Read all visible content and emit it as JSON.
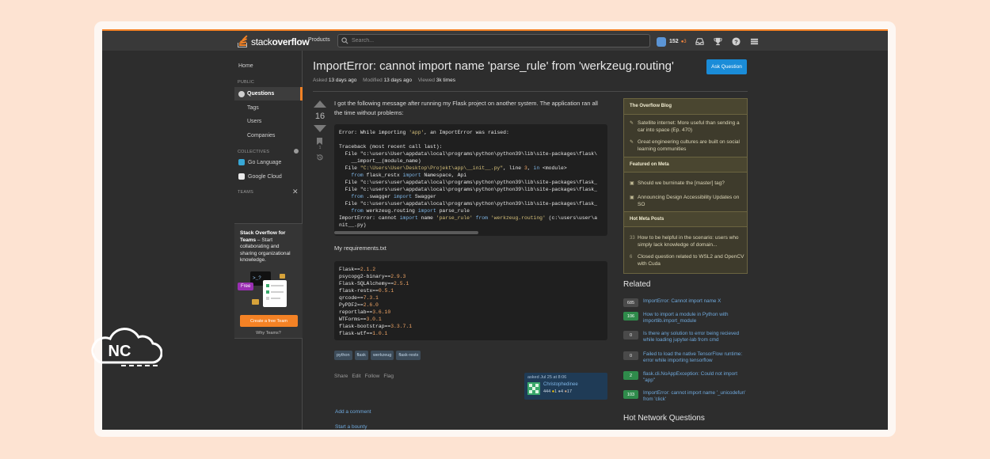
{
  "topbar": {
    "logo_light": "stack",
    "logo_bold": "overflow",
    "products": "Products",
    "search_placeholder": "Search...",
    "reputation": "152",
    "bronze_badges": "●3"
  },
  "leftnav": {
    "home": "Home",
    "public_header": "PUBLIC",
    "questions": "Questions",
    "tags": "Tags",
    "users": "Users",
    "companies": "Companies",
    "collectives_header": "COLLECTIVES",
    "collectives": [
      "Go Language",
      "Google Cloud"
    ],
    "teams_header": "TEAMS",
    "teams_title_bold": "Stack Overflow for Teams",
    "teams_title_rest": " – Start collaborating and sharing organizational knowledge.",
    "free_label": "Free",
    "create_team": "Create a free Team",
    "why_teams": "Why Teams?"
  },
  "question": {
    "title": "ImportError: cannot import name 'parse_rule' from 'werkzeug.routing'",
    "asked_label": "Asked",
    "asked_value": "13 days ago",
    "modified_label": "Modified",
    "modified_value": "13 days ago",
    "viewed_label": "Viewed",
    "viewed_value": "3k times",
    "ask_button": "Ask Question",
    "votes": "16",
    "bookmarks": "1",
    "body_text": "I got the following message after running my Flask project on another system. The application ran all the time without problems:",
    "requirements_label": "My requirements.txt",
    "tags": [
      "python",
      "flask",
      "werkzeug",
      "flask-restx"
    ],
    "actions": [
      "Share",
      "Edit",
      "Follow",
      "Flag"
    ],
    "owner": {
      "asked": "asked Jul 25 at 8:06",
      "name": "Christophedinee",
      "rep": "444",
      "gold": "1",
      "silver": "4",
      "bronze": "17"
    },
    "add_comment": "Add a comment",
    "start_bounty": "Start a bounty"
  },
  "code_traceback": [
    "Error: While importing 'app', an ImportError was raised:",
    "",
    "Traceback (most recent call last):",
    "  File \"c:\\users\\User\\appdata\\local\\programs\\python\\python39\\lib\\site-packages\\flask\\",
    "    __import__(module_name)",
    "  File \"C:\\Users\\User\\Desktop\\Projekt\\app\\__init__.py\", line 3, in <module>",
    "    from flask_restx import Namespace, Api",
    "  File \"c:\\users\\user\\appdata\\local\\programs\\python\\python39\\lib\\site-packages\\flask_",
    "  File \"c:\\users\\user\\appdata\\local\\programs\\python\\python39\\lib\\site-packages\\flask_",
    "    from .swagger import Swagger",
    "  File \"c:\\users\\user\\appdata\\local\\programs\\python\\python39\\lib\\site-packages\\flask_",
    "    from werkzeug.routing import parse_rule",
    "ImportError: cannot import name 'parse_rule' from 'werkzeug.routing' (c:\\users\\user\\a",
    "nit__.py)"
  ],
  "requirements": [
    {
      "pkg": "Flask",
      "ver": "2.1.2"
    },
    {
      "pkg": "psycopg2-binary",
      "ver": "2.9.3"
    },
    {
      "pkg": "Flask-SQLAlchemy",
      "ver": "2.5.1"
    },
    {
      "pkg": "flask-restx",
      "ver": "0.5.1"
    },
    {
      "pkg": "qrcode",
      "ver": "7.3.1"
    },
    {
      "pkg": "PyPDF2",
      "ver": "2.6.0"
    },
    {
      "pkg": "reportlab",
      "ver": "3.6.10"
    },
    {
      "pkg": "WTForms",
      "ver": "3.0.1"
    },
    {
      "pkg": "flask-bootstrap",
      "ver": "3.3.7.1"
    },
    {
      "pkg": "flask-wtf",
      "ver": "1.0.1"
    }
  ],
  "sidebar": {
    "blog_header": "The Overflow Blog",
    "blog_items": [
      "Satellite internet: More useful than sending a car into space (Ep. 470)",
      "Great engineering cultures are built on social learning communities"
    ],
    "meta_header": "Featured on Meta",
    "meta_items": [
      "Should we burninate the [master] tag?",
      "Announcing Design Accessibility Updates on SO"
    ],
    "hot_meta_header": "Hot Meta Posts",
    "hot_meta_items": [
      {
        "count": "33",
        "text": "How to be helpful in the scenario: users who simply lack knowledge of domain..."
      },
      {
        "count": "6",
        "text": "Closed question related to WSL2 and OpenCV with Cuda"
      }
    ],
    "related_header": "Related",
    "related": [
      {
        "score": "685",
        "accepted": false,
        "title": "ImportError: Cannot import name X"
      },
      {
        "score": "106",
        "accepted": true,
        "title": "How to import a module in Python with importlib.import_module"
      },
      {
        "score": "0",
        "accepted": false,
        "title": "Is there any solution to error being recieved while loading jupyter-lab from cmd"
      },
      {
        "score": "0",
        "accepted": false,
        "title": "Failed to load the native TensorFlow runtime: error while importing tensorflow"
      },
      {
        "score": "2",
        "accepted": true,
        "title": "flask.cli.NoAppException: Could not import \"app\""
      },
      {
        "score": "103",
        "accepted": true,
        "title": "ImportError: cannot import name '_unicodefun' from 'click'"
      }
    ],
    "hnq_header": "Hot Network Questions"
  },
  "badge": {
    "text": "NC"
  },
  "colors": {
    "background": "#fde3d2",
    "screen": "#2d2d2d",
    "accent_orange": "#f48225",
    "link_blue": "#6fa9dd",
    "button_blue": "#1a8cd8",
    "accepted_green": "#2f8b4b"
  }
}
